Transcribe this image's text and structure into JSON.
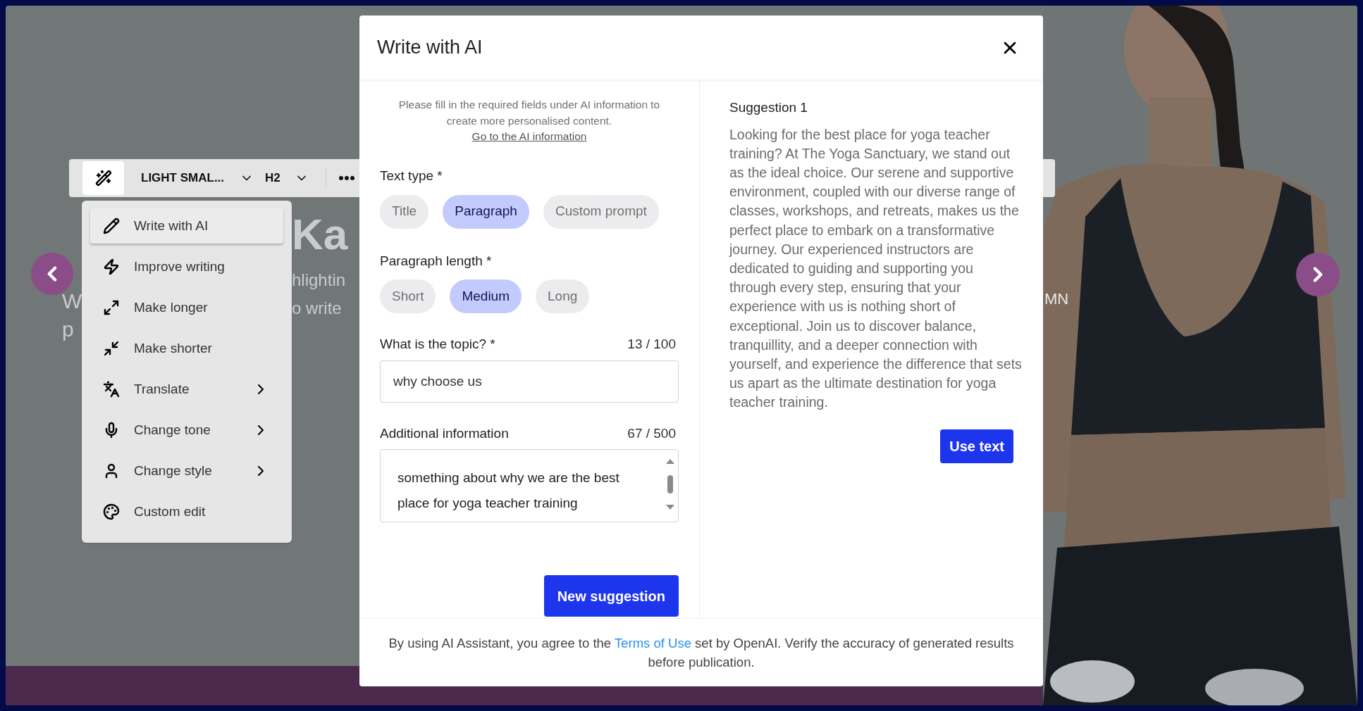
{
  "toolbar": {
    "font_preset": "LIGHT SMAL...",
    "heading_level": "H2"
  },
  "background_text": {
    "heading_fragment": "Ka",
    "line_1_left": "W",
    "line_2_left": "p",
    "line_1_fragment": "hlightin",
    "line_2_fragment": "o write",
    "photo_fragment": "MN"
  },
  "ai_menu": {
    "items": [
      {
        "label": "Write with AI",
        "kind": "action",
        "selected": true
      },
      {
        "label": "Improve writing",
        "kind": "action",
        "selected": false
      },
      {
        "label": "Make longer",
        "kind": "action",
        "selected": false
      },
      {
        "label": "Make shorter",
        "kind": "action",
        "selected": false
      },
      {
        "label": "Translate",
        "kind": "submenu",
        "selected": false
      },
      {
        "label": "Change tone",
        "kind": "submenu",
        "selected": false
      },
      {
        "label": "Change style",
        "kind": "submenu",
        "selected": false
      },
      {
        "label": "Custom edit",
        "kind": "action",
        "selected": false
      }
    ]
  },
  "dialog": {
    "title": "Write with AI",
    "notice": "Please fill in the required fields under AI information to create more personalised content.",
    "notice_link": "Go to the AI information",
    "text_type": {
      "label": "Text type *",
      "options": [
        {
          "label": "Title",
          "selected": false
        },
        {
          "label": "Paragraph",
          "selected": true
        },
        {
          "label": "Custom prompt",
          "selected": false
        }
      ]
    },
    "paragraph_length": {
      "label": "Paragraph length *",
      "options": [
        {
          "label": "Short",
          "selected": false
        },
        {
          "label": "Medium",
          "selected": true
        },
        {
          "label": "Long",
          "selected": false
        }
      ]
    },
    "topic": {
      "label": "What is the topic? *",
      "counter": "13 / 100",
      "value": "why choose us"
    },
    "additional_info": {
      "label": "Additional information",
      "counter": "67 / 500",
      "value": "something about why we are the best place for yoga teacher training"
    },
    "new_suggestion_button": "New suggestion",
    "suggestion": {
      "title": "Suggestion 1",
      "text": "Looking for the best place for yoga teacher training? At The Yoga Sanctuary, we stand out as the ideal choice. Our serene and supportive environment, coupled with our diverse range of classes, workshops, and retreats, makes us the perfect place to embark on a transformative journey. Our experienced instructors are dedicated to guiding and supporting you through every step, ensuring that your experience with us is nothing short of exceptional. Join us to discover balance, tranquillity, and a deeper connection with yourself, and experience the difference that sets us apart as the ultimate destination for yoga teacher training.",
      "button": "Use text"
    },
    "footer": {
      "before": "By using AI Assistant, you agree to the",
      "link": "Terms of Use",
      "after": "set by OpenAI. Verify the accuracy of generated results before publication."
    }
  }
}
